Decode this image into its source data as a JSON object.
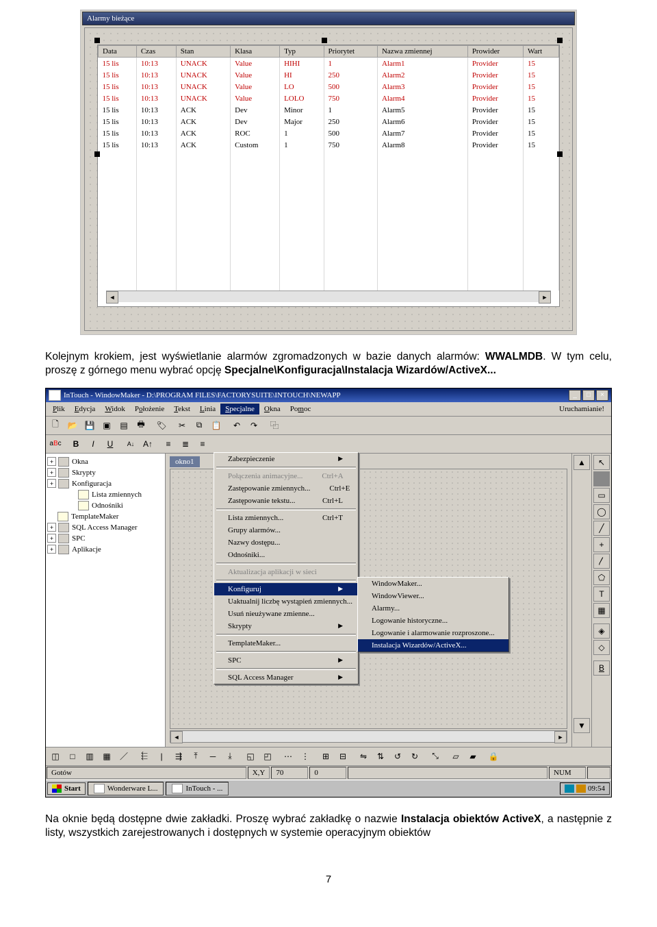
{
  "fig1": {
    "title": "Alarmy bieżące",
    "columns": [
      "Data",
      "Czas",
      "Stan",
      "Klasa",
      "Typ",
      "Priorytet",
      "Nazwa zmiennej",
      "Prowider",
      "Wart"
    ],
    "rows": [
      {
        "red": true,
        "cells": [
          "15 lis",
          "10:13",
          "UNACK",
          "Value",
          "HIHI",
          "1",
          "Alarm1",
          "Provider",
          "15"
        ]
      },
      {
        "red": true,
        "cells": [
          "15 lis",
          "10:13",
          "UNACK",
          "Value",
          "HI",
          "250",
          "Alarm2",
          "Provider",
          "15"
        ]
      },
      {
        "red": true,
        "cells": [
          "15 lis",
          "10:13",
          "UNACK",
          "Value",
          "LO",
          "500",
          "Alarm3",
          "Provider",
          "15"
        ]
      },
      {
        "red": true,
        "cells": [
          "15 lis",
          "10:13",
          "UNACK",
          "Value",
          "LOLO",
          "750",
          "Alarm4",
          "Provider",
          "15"
        ]
      },
      {
        "red": false,
        "cells": [
          "15 lis",
          "10:13",
          "ACK",
          "Dev",
          "Minor",
          "1",
          "Alarm5",
          "Provider",
          "15"
        ]
      },
      {
        "red": false,
        "cells": [
          "15 lis",
          "10:13",
          "ACK",
          "Dev",
          "Major",
          "250",
          "Alarm6",
          "Provider",
          "15"
        ]
      },
      {
        "red": false,
        "cells": [
          "15 lis",
          "10:13",
          "ACK",
          "ROC",
          "1",
          "500",
          "Alarm7",
          "Provider",
          "15"
        ]
      },
      {
        "red": false,
        "cells": [
          "15 lis",
          "10:13",
          "ACK",
          "Custom",
          "1",
          "750",
          "Alarm8",
          "Provider",
          "15"
        ]
      }
    ],
    "blank_rows": 12
  },
  "para1": {
    "pre": "Kolejnym krokiem, jest wyświetlanie alarmów zgromadzonych w bazie danych alarmów: ",
    "bold1": "WWALMDB",
    "mid": ". W tym celu, proszę z górnego menu wybrać opcję ",
    "bold2": "Specjalne\\Konfiguracja\\Instalacja Wizardów/ActiveX...",
    "post": ""
  },
  "fig2": {
    "title": "InTouch - WindowMaker - D:\\PROGRAM FILES\\FACTORYSUITE\\INTOUCH\\NEWAPP",
    "menubar": [
      {
        "label": "Plik",
        "u": "P"
      },
      {
        "label": "Edycja",
        "u": "E"
      },
      {
        "label": "Widok",
        "u": "W"
      },
      {
        "label": "Położenie",
        "u": "o"
      },
      {
        "label": "Tekst",
        "u": "T"
      },
      {
        "label": "Linia",
        "u": "L"
      },
      {
        "label": "Specjalne",
        "u": "S",
        "sel": true
      },
      {
        "label": "Okna",
        "u": "O"
      },
      {
        "label": "Pomoc",
        "u": "m"
      }
    ],
    "run": "Uruchamianie!",
    "tree": [
      {
        "exp": "+",
        "label": "Okna"
      },
      {
        "exp": "+",
        "label": "Skrypty"
      },
      {
        "exp": "+",
        "label": "Konfiguracja"
      },
      {
        "exp": "",
        "label": "Lista zmiennych",
        "indent": 1
      },
      {
        "exp": "",
        "label": "Odnośniki",
        "indent": 1
      },
      {
        "exp": "",
        "label": "TemplateMaker"
      },
      {
        "exp": "+",
        "label": "SQL Access Manager"
      },
      {
        "exp": "+",
        "label": "SPC"
      },
      {
        "exp": "+",
        "label": "Aplikacje"
      }
    ],
    "canvasTab": "okno1",
    "menu1": [
      {
        "t": "sub",
        "label": "Zabezpieczenie"
      },
      {
        "t": "sep"
      },
      {
        "t": "i",
        "dis": true,
        "label": "Połączenia animacyjne...",
        "scut": "Ctrl+A"
      },
      {
        "t": "i",
        "label": "Zastępowanie zmiennych...",
        "scut": "Ctrl+E"
      },
      {
        "t": "i",
        "label": "Zastępowanie tekstu...",
        "scut": "Ctrl+L"
      },
      {
        "t": "sep"
      },
      {
        "t": "i",
        "label": "Lista zmiennych...",
        "scut": "Ctrl+T"
      },
      {
        "t": "i",
        "label": "Grupy alarmów..."
      },
      {
        "t": "i",
        "label": "Nazwy dostępu..."
      },
      {
        "t": "i",
        "label": "Odnośniki..."
      },
      {
        "t": "sep"
      },
      {
        "t": "i",
        "dis": true,
        "label": "Aktualizacja aplikacji w sieci"
      },
      {
        "t": "sep"
      },
      {
        "t": "sub",
        "sel": true,
        "label": "Konfiguruj"
      },
      {
        "t": "i",
        "label": "Uaktualnij liczbę wystąpień zmiennych..."
      },
      {
        "t": "i",
        "label": "Usuń nieużywane zmienne..."
      },
      {
        "t": "sub",
        "label": "Skrypty"
      },
      {
        "t": "sep"
      },
      {
        "t": "i",
        "label": "TemplateMaker..."
      },
      {
        "t": "sep"
      },
      {
        "t": "sub",
        "label": "SPC"
      },
      {
        "t": "sep"
      },
      {
        "t": "sub",
        "label": "SQL Access Manager"
      }
    ],
    "menu2": [
      {
        "t": "i",
        "label": "WindowMaker..."
      },
      {
        "t": "i",
        "label": "WindowViewer..."
      },
      {
        "t": "i",
        "label": "Alarmy..."
      },
      {
        "t": "i",
        "label": "Logowanie historyczne..."
      },
      {
        "t": "i",
        "label": "Logowanie i alarmowanie rozproszone..."
      },
      {
        "t": "i",
        "sel": true,
        "label": "Instalacja Wizardów/ActiveX..."
      }
    ],
    "status": {
      "ready": "Gotów",
      "xy": "X,Y",
      "x": "70",
      "y": "0",
      "num": "NUM"
    },
    "taskbar": {
      "start": "Start",
      "t1": "Wonderware L...",
      "t2": "InTouch - ...",
      "clock": "09:54"
    }
  },
  "para2": {
    "pre": "Na oknie będą dostępne dwie zakładki. Proszę wybrać zakładkę o nazwie ",
    "bold": "Instalacja obiektów ActiveX",
    "post": ", a następnie z listy, wszystkich zarejestrowanych i dostępnych w systemie operacyjnym obiektów"
  },
  "pageNum": "7"
}
